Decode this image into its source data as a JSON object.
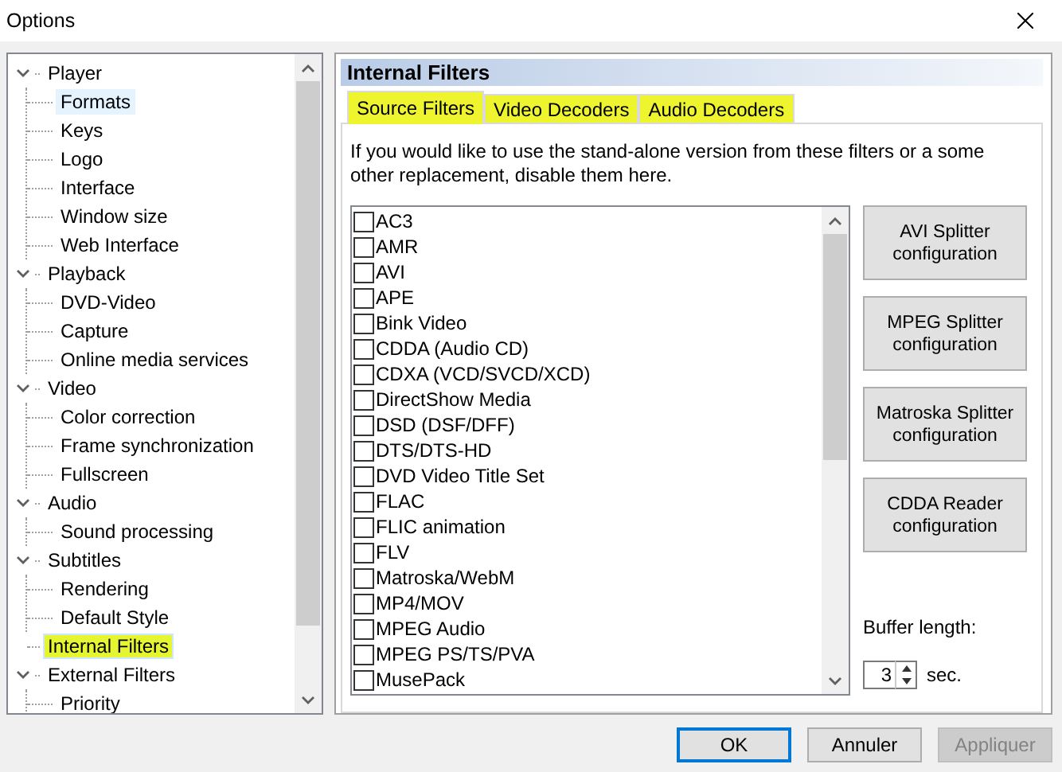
{
  "window": {
    "title": "Options"
  },
  "tree": [
    {
      "label": "Player",
      "expanded": true,
      "selected": false,
      "hovered": false,
      "highlighted": false,
      "children": [
        {
          "label": "Formats",
          "selected": false,
          "hovered": true,
          "highlighted": false
        },
        {
          "label": "Keys",
          "selected": false,
          "hovered": false,
          "highlighted": false
        },
        {
          "label": "Logo",
          "selected": false,
          "hovered": false,
          "highlighted": false
        },
        {
          "label": "Interface",
          "selected": false,
          "hovered": false,
          "highlighted": false
        },
        {
          "label": "Window size",
          "selected": false,
          "hovered": false,
          "highlighted": false
        },
        {
          "label": "Web Interface",
          "selected": false,
          "hovered": false,
          "highlighted": false
        }
      ]
    },
    {
      "label": "Playback",
      "expanded": true,
      "selected": false,
      "hovered": false,
      "highlighted": false,
      "children": [
        {
          "label": "DVD-Video",
          "selected": false,
          "hovered": false,
          "highlighted": false
        },
        {
          "label": "Capture",
          "selected": false,
          "hovered": false,
          "highlighted": false
        },
        {
          "label": "Online media services",
          "selected": false,
          "hovered": false,
          "highlighted": false
        }
      ]
    },
    {
      "label": "Video",
      "expanded": true,
      "selected": false,
      "hovered": false,
      "highlighted": false,
      "children": [
        {
          "label": "Color correction",
          "selected": false,
          "hovered": false,
          "highlighted": false
        },
        {
          "label": "Frame synchronization",
          "selected": false,
          "hovered": false,
          "highlighted": false
        },
        {
          "label": "Fullscreen",
          "selected": false,
          "hovered": false,
          "highlighted": false
        }
      ]
    },
    {
      "label": "Audio",
      "expanded": true,
      "selected": false,
      "hovered": false,
      "highlighted": false,
      "children": [
        {
          "label": "Sound processing",
          "selected": false,
          "hovered": false,
          "highlighted": false
        }
      ]
    },
    {
      "label": "Subtitles",
      "expanded": true,
      "selected": false,
      "hovered": false,
      "highlighted": false,
      "children": [
        {
          "label": "Rendering",
          "selected": false,
          "hovered": false,
          "highlighted": false
        },
        {
          "label": "Default Style",
          "selected": false,
          "hovered": false,
          "highlighted": false
        }
      ]
    },
    {
      "label": "Internal Filters",
      "selected": true,
      "hovered": false,
      "highlighted": true
    },
    {
      "label": "External Filters",
      "expanded": true,
      "selected": false,
      "hovered": false,
      "highlighted": false,
      "children": [
        {
          "label": "Priority",
          "selected": false,
          "hovered": false,
          "highlighted": false
        }
      ]
    }
  ],
  "page": {
    "title": "Internal Filters",
    "tabs": [
      {
        "label": "Source Filters",
        "selected": true,
        "highlighted": true
      },
      {
        "label": "Video Decoders",
        "selected": false,
        "highlighted": true
      },
      {
        "label": "Audio Decoders",
        "selected": false,
        "highlighted": true
      }
    ],
    "description": "If you would like to use the stand-alone version from these filters or a some other replacement, disable them here.",
    "filters": [
      {
        "label": "AC3",
        "checked": false
      },
      {
        "label": "AMR",
        "checked": false
      },
      {
        "label": "AVI",
        "checked": false
      },
      {
        "label": "APE",
        "checked": false
      },
      {
        "label": "Bink Video",
        "checked": false
      },
      {
        "label": "CDDA (Audio CD)",
        "checked": false
      },
      {
        "label": "CDXA (VCD/SVCD/XCD)",
        "checked": false
      },
      {
        "label": "DirectShow Media",
        "checked": false
      },
      {
        "label": "DSD (DSF/DFF)",
        "checked": false
      },
      {
        "label": "DTS/DTS-HD",
        "checked": false
      },
      {
        "label": "DVD Video Title Set",
        "checked": false
      },
      {
        "label": "FLAC",
        "checked": false
      },
      {
        "label": "FLIC animation",
        "checked": false
      },
      {
        "label": "FLV",
        "checked": false
      },
      {
        "label": "Matroska/WebM",
        "checked": false
      },
      {
        "label": "MP4/MOV",
        "checked": false
      },
      {
        "label": "MPEG Audio",
        "checked": false
      },
      {
        "label": "MPEG PS/TS/PVA",
        "checked": false
      },
      {
        "label": "MusePack",
        "checked": false
      }
    ],
    "config_buttons": [
      "AVI Splitter configuration",
      "MPEG Splitter configuration",
      "Matroska Splitter configuration",
      "CDDA Reader configuration"
    ],
    "buffer": {
      "label": "Buffer length:",
      "value": "3",
      "unit": "sec."
    }
  },
  "buttons": [
    {
      "label": "OK",
      "default": true,
      "disabled": false
    },
    {
      "label": "Annuler",
      "default": false,
      "disabled": false
    },
    {
      "label": "Appliquer",
      "default": false,
      "disabled": true
    }
  ]
}
